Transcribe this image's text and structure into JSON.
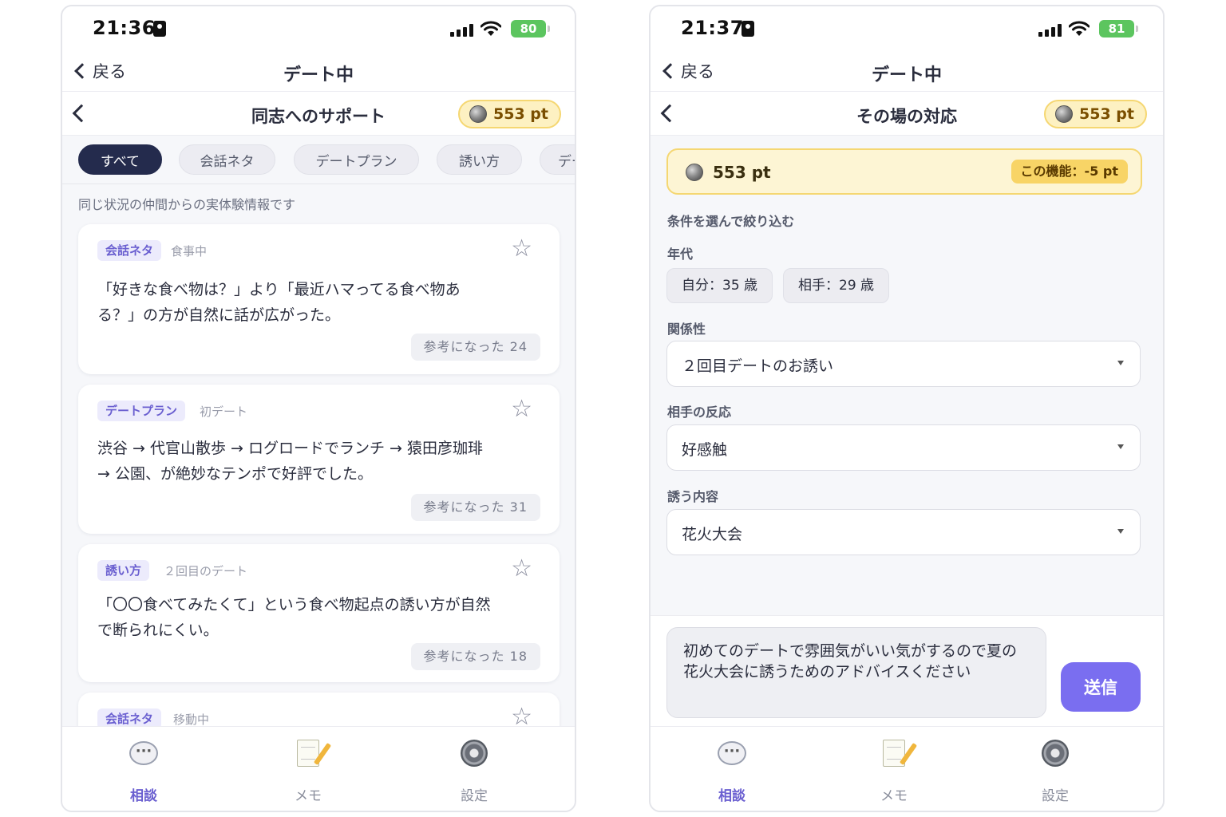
{
  "left": {
    "status": {
      "time": "21:36",
      "battery": "80"
    },
    "nav": {
      "back_label": "戻る",
      "title": "デート中"
    },
    "sub": {
      "title": "同志へのサポート",
      "points": "553 pt"
    },
    "chips": [
      "すべて",
      "会話ネタ",
      "デートプラン",
      "誘い方",
      "デー"
    ],
    "intro": "同じ状況の仲間からの実体験情報です",
    "cards": [
      {
        "tag": "会話ネタ",
        "sub": "食事中",
        "text": "「好きな食べ物は？」より「最近ハマってる食べ物ある？」の方が自然に話が広がった。",
        "helpful": "参考になった 24"
      },
      {
        "tag": "デートプラン",
        "sub": "初デート",
        "text": "渋谷 → 代官山散歩 → ログロードでランチ → 猿田彦珈琲 → 公園、が絶妙なテンポで好評でした。",
        "helpful": "参考になった 31"
      },
      {
        "tag": "誘い方",
        "sub": "２回目のデート",
        "text": "「〇〇食べてみたくて」という食べ物起点の誘い方が自然で断られにくい。",
        "helpful": "参考になった 18"
      },
      {
        "tag": "会話ネタ",
        "sub": "移動中"
      }
    ],
    "tabs": [
      "相談",
      "メモ",
      "設定"
    ]
  },
  "right": {
    "status": {
      "time": "21:37",
      "battery": "81"
    },
    "nav": {
      "back_label": "戻る",
      "title": "デート中"
    },
    "sub": {
      "title": "その場の対応",
      "points": "553 pt"
    },
    "balance": {
      "value": "553 pt",
      "cost": "この機能：-5 pt"
    },
    "filter_heading": "条件を選んで絞り込む",
    "age": {
      "label": "年代",
      "self": "自分：35 歳",
      "partner": "相手：29 歳"
    },
    "relation": {
      "label": "関係性",
      "value": "２回目デートのお誘い"
    },
    "reaction": {
      "label": "相手の反応",
      "value": "好感触"
    },
    "invite": {
      "label": "誘う内容",
      "value": "花火大会"
    },
    "message": "初めてのデートで雰囲気がいい気がするので夏の花火大会に誘うためのアドバイスください",
    "send_label": "送信",
    "tabs": [
      "相談",
      "メモ",
      "設定"
    ]
  }
}
